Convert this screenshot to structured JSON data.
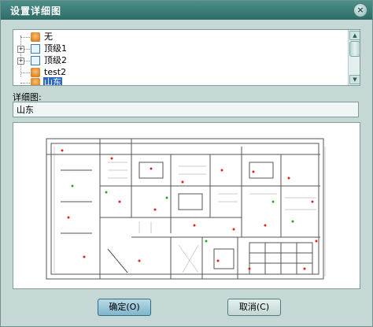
{
  "dialog": {
    "title": "设置详细图"
  },
  "tree": {
    "items": [
      {
        "label": "无",
        "icon": "person-icon",
        "expandable": false,
        "selected": false
      },
      {
        "label": "顶级1",
        "icon": "grid-icon",
        "expandable": true,
        "selected": false
      },
      {
        "label": "顶级2",
        "icon": "grid-icon",
        "expandable": true,
        "selected": false
      },
      {
        "label": "test2",
        "icon": "person-icon",
        "expandable": false,
        "selected": false
      },
      {
        "label": "山东",
        "icon": "person-icon",
        "expandable": false,
        "selected": true
      }
    ]
  },
  "detail": {
    "label": "详细图:",
    "value": "山东"
  },
  "buttons": {
    "ok": "确定(O)",
    "cancel": "取消(C)"
  }
}
